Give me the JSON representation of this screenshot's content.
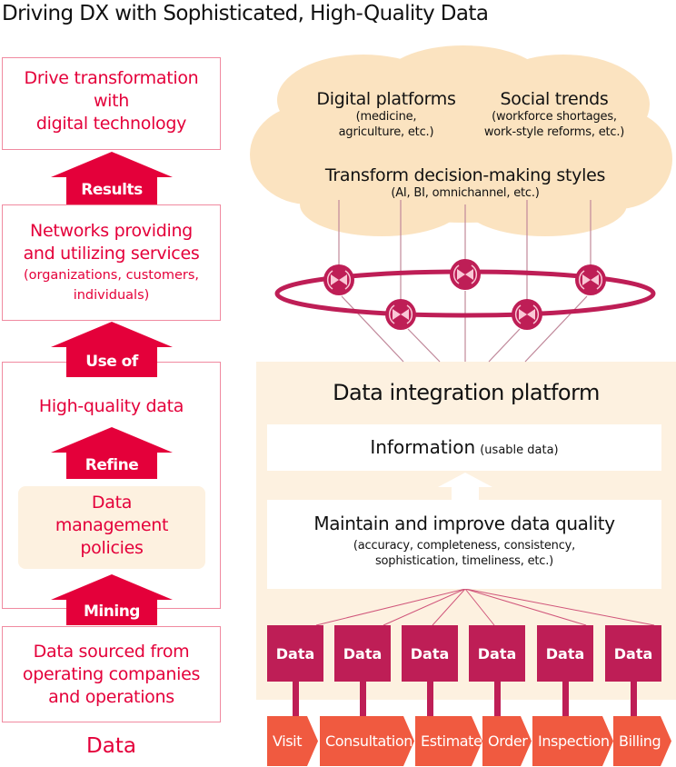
{
  "title": "Driving DX with Sophisticated, High-Quality Data",
  "colors": {
    "accent_red": "#e4003a",
    "data_magenta": "#be1e56",
    "process_orange": "#f05a40",
    "cloud_beige": "#fbe3c0",
    "platform_beige": "#fdf1e0"
  },
  "left": {
    "box1": [
      "Drive transformation",
      "with",
      "digital technology"
    ],
    "arrow1": "Results",
    "box2": {
      "main": [
        "Networks providing",
        "and utilizing services"
      ],
      "sub": [
        "(organizations, customers,",
        "individuals)"
      ]
    },
    "arrow2": "Use of data",
    "box3_label": "High-quality data",
    "arrow3": "Refine",
    "policies": [
      "Data",
      "management",
      "policies"
    ],
    "arrow4": "Mining",
    "box4": [
      "Data sourced from",
      "operating companies",
      "and operations"
    ],
    "footer": "Data"
  },
  "cloud": {
    "platforms": {
      "title": "Digital platforms",
      "sub": [
        "(medicine,",
        "agriculture, etc.)"
      ]
    },
    "trends": {
      "title": "Social trends",
      "sub": [
        "(workforce shortages,",
        "work-style reforms, etc.)"
      ]
    },
    "decision": {
      "title": "Transform decision-making styles",
      "sub": "(AI, BI, omnichannel, etc.)"
    }
  },
  "platform": {
    "title": "Data integration platform",
    "information": {
      "title": "Information",
      "sub": "(usable data)"
    },
    "quality": {
      "title": "Maintain and improve data quality",
      "sub": [
        "(accuracy, completeness, consistency,",
        "sophistication, timeliness, etc.)"
      ]
    },
    "data_label": "Data",
    "processes": [
      "Visit",
      "Consultation",
      "Estimate",
      "Order",
      "Inspection",
      "Billing"
    ]
  }
}
